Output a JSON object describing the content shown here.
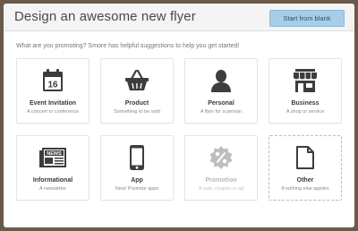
{
  "header": {
    "title": "Design an awesome new flyer",
    "start_blank_label": "Start from blank"
  },
  "subtitle": "What are you promoting? Smore has helpful suggestions to help you get started!",
  "cards": [
    {
      "title": "Event Invitation",
      "subtitle": "A concert or conference",
      "icon": "calendar-icon",
      "calendar_day": "16",
      "enabled": true
    },
    {
      "title": "Product",
      "subtitle": "Something to be sold",
      "icon": "shopping-basket-icon",
      "enabled": true
    },
    {
      "title": "Personal",
      "subtitle": "A flyer for a person",
      "icon": "person-icon",
      "enabled": true
    },
    {
      "title": "Business",
      "subtitle": "A shop or service",
      "icon": "storefront-icon",
      "enabled": true
    },
    {
      "title": "Informational",
      "subtitle": "A newsletter",
      "icon": "newspaper-icon",
      "news_label": "NEWS",
      "enabled": true
    },
    {
      "title": "App",
      "subtitle": "New! Promote apps",
      "icon": "smartphone-icon",
      "enabled": true
    },
    {
      "title": "Promotion",
      "subtitle": "A sale, coupon or ad",
      "icon": "percent-badge-icon",
      "enabled": false
    },
    {
      "title": "Other",
      "subtitle": "If nothing else applies",
      "icon": "document-icon",
      "enabled": true
    }
  ],
  "colors": {
    "icon": "#3d3d3d",
    "icon_disabled": "#bdbdbd",
    "button_bg": "#a9cde6",
    "header_bg": "#f4f4f4",
    "backdrop": "#6b5a4a"
  }
}
